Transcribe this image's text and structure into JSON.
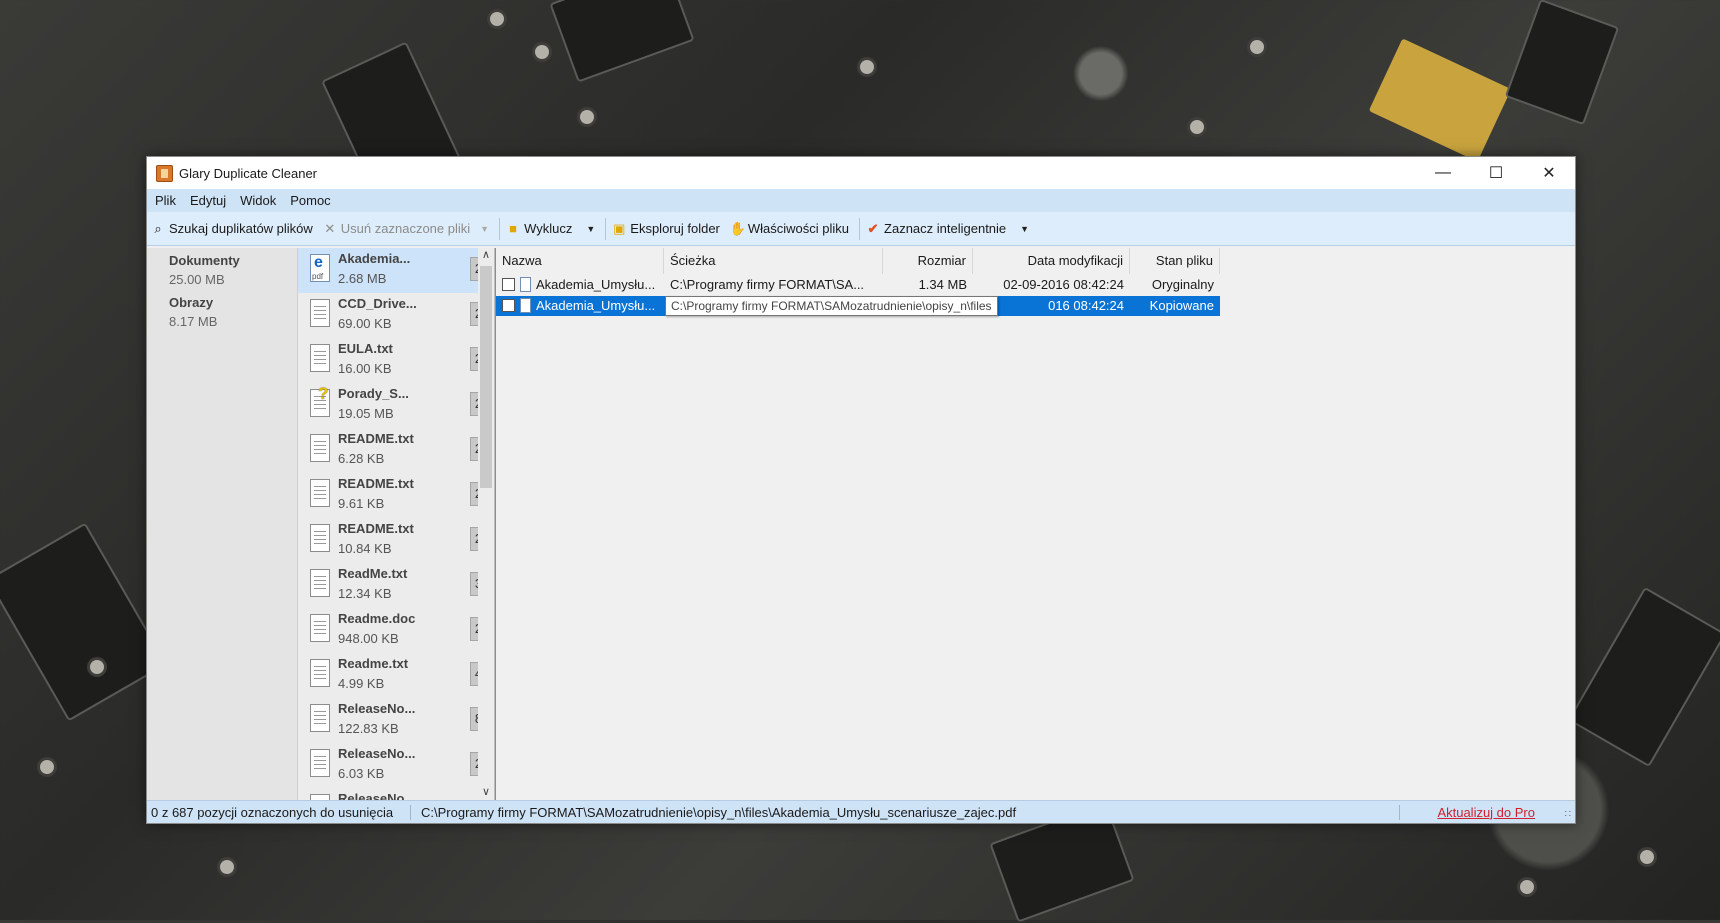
{
  "window": {
    "title": "Glary Duplicate Cleaner"
  },
  "menu": [
    "Plik",
    "Edytuj",
    "Widok",
    "Pomoc"
  ],
  "toolbar": {
    "search": "Szukaj duplikatów plików",
    "delete": "Usuń zaznaczone pliki",
    "exclude": "Wyklucz",
    "explore": "Eksploruj folder",
    "properties": "Właściwości pliku",
    "smart": "Zaznacz inteligentnie"
  },
  "categories": [
    {
      "name": "Dokumenty",
      "size": "25.00 MB"
    },
    {
      "name": "Obrazy",
      "size": "8.17 MB"
    }
  ],
  "files": [
    {
      "name": "Akademia...",
      "size": "2.68 MB",
      "count": "2",
      "icon": "pdf-icon"
    },
    {
      "name": "CCD_Drive...",
      "size": "69.00 KB",
      "count": "2",
      "icon": "doc-icon"
    },
    {
      "name": "EULA.txt",
      "size": "16.00 KB",
      "count": "2",
      "icon": "txt-icon"
    },
    {
      "name": "Porady_S...",
      "size": "19.05 MB",
      "count": "2",
      "icon": "help-file-icon"
    },
    {
      "name": "README.txt",
      "size": "6.28 KB",
      "count": "2",
      "icon": "txt-icon"
    },
    {
      "name": "README.txt",
      "size": "9.61 KB",
      "count": "2",
      "icon": "txt-icon"
    },
    {
      "name": "README.txt",
      "size": "10.84 KB",
      "count": "2",
      "icon": "txt-icon"
    },
    {
      "name": "ReadMe.txt",
      "size": "12.34 KB",
      "count": "3",
      "icon": "txt-icon"
    },
    {
      "name": "Readme.doc",
      "size": "948.00 KB",
      "count": "2",
      "icon": "doc-icon"
    },
    {
      "name": "Readme.txt",
      "size": "4.99 KB",
      "count": "4",
      "icon": "txt-icon"
    },
    {
      "name": "ReleaseNo...",
      "size": "122.83 KB",
      "count": "8",
      "icon": "txt-icon"
    },
    {
      "name": "ReleaseNo...",
      "size": "6.03 KB",
      "count": "2",
      "icon": "txt-icon"
    },
    {
      "name": "ReleaseNo...",
      "size": "",
      "count": "",
      "icon": "txt-icon"
    }
  ],
  "columns": [
    "Nazwa",
    "Ścieżka",
    "Rozmiar",
    "Data modyfikacji",
    "Stan pliku"
  ],
  "rows": [
    {
      "name": "Akademia_Umysłu...",
      "path": "C:\\Programy firmy FORMAT\\SA...",
      "size": "1.34 MB",
      "date": "02-09-2016 08:42:24",
      "state": "Oryginalny"
    },
    {
      "name": "Akademia_Umysłu...",
      "path": "",
      "size": "",
      "date": "016 08:42:24",
      "state": "Kopiowane"
    }
  ],
  "tooltip": "C:\\Programy firmy FORMAT\\SAMozatrudnienie\\opisy_n\\files",
  "status": {
    "selected": "0 z 687 pozycji oznaczonych do usunięcia",
    "path": "C:\\Programy firmy FORMAT\\SAMozatrudnienie\\opisy_n\\files\\Akademia_Umysłu_scenariusze_zajec.pdf",
    "upgrade": "Aktualizuj do Pro"
  }
}
